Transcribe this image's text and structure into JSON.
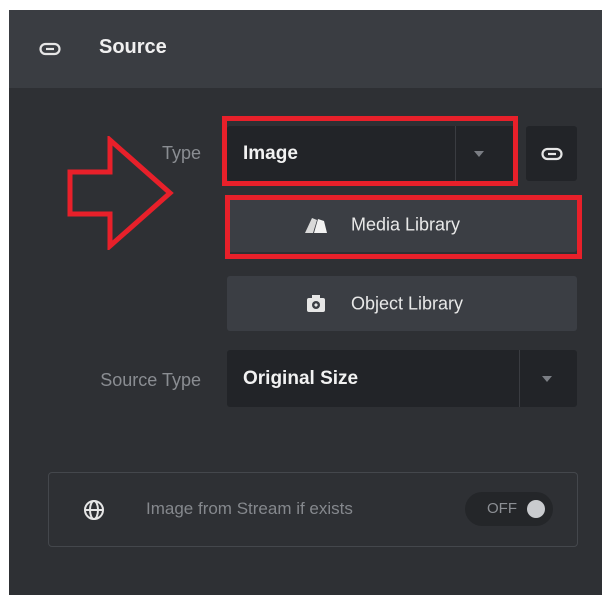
{
  "header": {
    "title": "Source",
    "icon": "link-icon"
  },
  "type_field": {
    "label": "Type",
    "value": "Image",
    "link_icon": "link-icon"
  },
  "buttons": {
    "media_library": {
      "label": "Media Library",
      "icon": "media-library-icon"
    },
    "object_library": {
      "label": "Object Library",
      "icon": "object-library-icon"
    }
  },
  "source_type_field": {
    "label": "Source Type",
    "value": "Original Size"
  },
  "stream_option": {
    "label": "Image from Stream if exists",
    "icon": "globe-icon",
    "toggle_state": "OFF"
  },
  "colors": {
    "panel_bg": "#2e3034",
    "header_bg": "#3a3d42",
    "input_bg": "#222428",
    "button_bg": "#3b3e44",
    "annotation_red": "#e8202a"
  }
}
